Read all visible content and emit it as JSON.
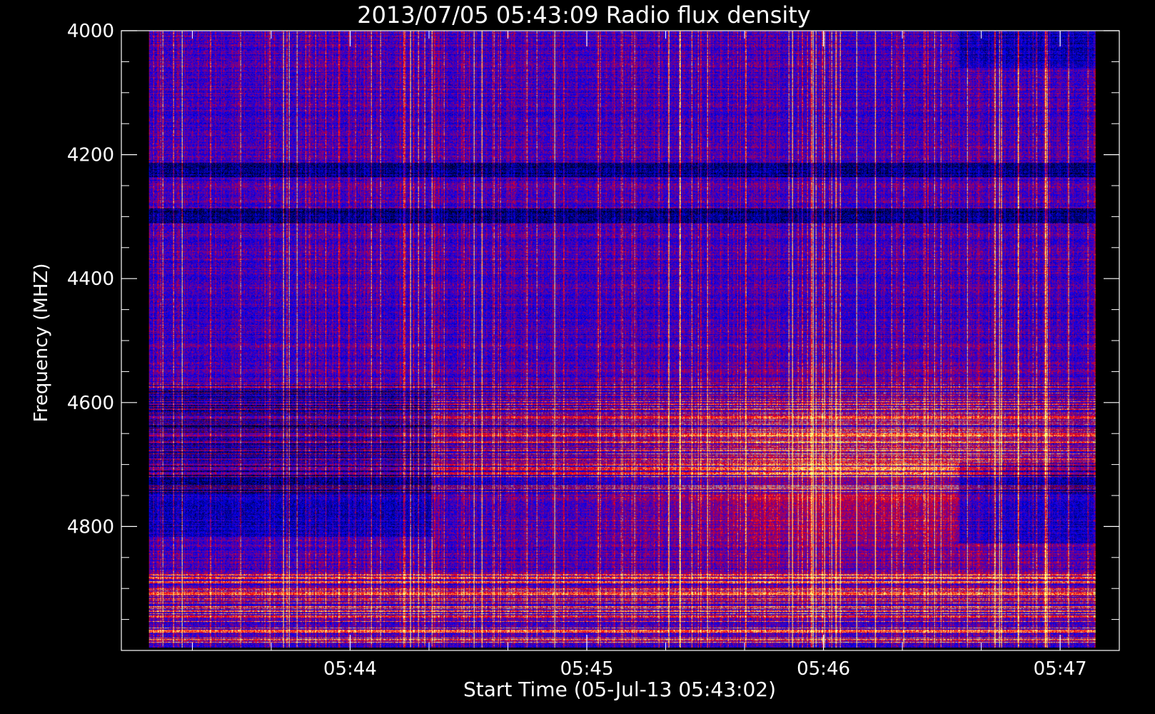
{
  "chart_data": {
    "type": "heatmap",
    "title": "2013/07/05 05:43:09 Radio flux density",
    "xlabel": "Start Time (05-Jul-13 05:43:02)",
    "ylabel": "Frequency (MHZ)",
    "x_ticks": [
      "05:44",
      "05:45",
      "05:46",
      "05:47"
    ],
    "y_ticks": [
      "4000",
      "4200",
      "4400",
      "4600",
      "4800"
    ],
    "xlim": [
      "05:43:02",
      "05:47:15"
    ],
    "ylim": [
      4000,
      5000
    ],
    "data_time_range": [
      "05:43:09",
      "05:47:09"
    ],
    "data_freq_range": [
      4000,
      4995
    ],
    "y_inverted": true,
    "colormap": [
      "#000000",
      "#0000ff",
      "#ff0000",
      "#ffff80"
    ]
  }
}
